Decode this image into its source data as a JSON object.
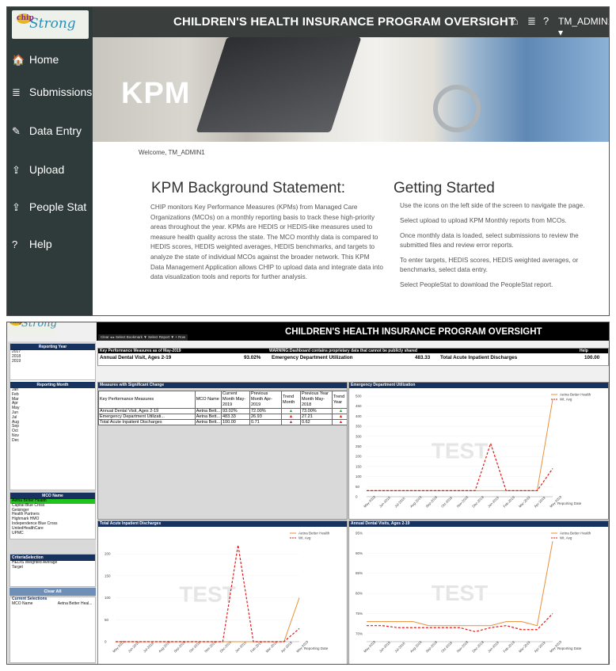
{
  "kpm_page": {
    "logo_text": "Strong",
    "logo_badge": "chip",
    "nav": [
      {
        "label": "Home",
        "icon": "home-icon",
        "glyph": "🏠",
        "active": true
      },
      {
        "label": "Submissions",
        "icon": "server-icon",
        "glyph": "≣"
      },
      {
        "label": "Data Entry",
        "icon": "pencil-icon",
        "glyph": "✎"
      },
      {
        "label": "Upload",
        "icon": "upload-icon",
        "glyph": "⇪"
      },
      {
        "label": "People Stat",
        "icon": "upload-icon",
        "glyph": "⇪"
      },
      {
        "label": "Help",
        "icon": "question-icon",
        "glyph": "?"
      }
    ],
    "header_title": "CHILDREN'S HEALTH INSURANCE PROGRAM OVERSIGHT",
    "user": "TM_ADMIN1 ▾",
    "hero_title": "KPM",
    "welcome": "Welcome, TM_ADMIN1",
    "background_heading": "KPM Background Statement:",
    "background_text": "CHIP monitors Key Performance Measures (KPMs) from Managed Care Organizations (MCOs) on a monthly reporting basis to track these high-priority areas throughout the year. KPMs are HEDIS or HEDIS-like measures used to measure health quality across the state. The MCO monthly data is compared to HEDIS scores, HEDIS weighted averages, HEDIS benchmarks, and targets to analyze the state of individual MCOs against the broader network. This KPM Data Management Application allows CHIP to upload data and integrate data into data visualization tools and reports for further analysis.",
    "getting_started_heading": "Getting Started",
    "getting_started": [
      "Use the icons on the left side of the screen to navigate the page.",
      "Select upload to upload KPM Monthly reports from MCOs.",
      "Once monthly data is loaded, select submissions to review the submitted files and review error reports.",
      "To enter targets, HEDIS scores, HEDIS weighted averages, or benchmarks, select data entry.",
      "Select PeopleStat to download the PeopleStat report."
    ],
    "accent": "#2f3b3a"
  },
  "dashboard": {
    "title": "CHILDREN'S HEALTH INSURANCE PROGRAM OVERSIGHT",
    "toolbar": "Clear  ◂  ▸  Select Bookmark ▼  Select Report ▼  + Row",
    "reporting_year": {
      "label": "Reporting Year",
      "items": [
        "2017",
        "2018",
        "2019"
      ]
    },
    "reporting_month": {
      "label": "Reporting Month",
      "items": [
        "Jan",
        "Feb",
        "Mar",
        "Apr",
        "May",
        "Jun",
        "Jul",
        "Aug",
        "Sep",
        "Oct",
        "Nov",
        "Dec"
      ]
    },
    "mco_name": {
      "label": "MCO Name",
      "items": [
        "Aetna Better Health",
        "Capital Blue Cross",
        "Geisinger",
        "Health Partners",
        "Highmark HMO",
        "Independence Blue Cross",
        "UnitedHealthCare",
        "UPMC"
      ],
      "selected": "Aetna Better Health"
    },
    "criteria": {
      "label": "CriteriaSelection",
      "items": [
        "HEDIS Weighted Average",
        "Target"
      ]
    },
    "clear_all": "Clear All",
    "current_selections": {
      "label": "Current Selections",
      "field": "MCO Name",
      "value": "Aetna Better Heal..."
    },
    "kpm_header": "Key Performance Measures as of May-2019",
    "warning": "WARNING:Dashboard contains proprietary data that cannot be publicly shared",
    "help": "Help",
    "kpis": [
      {
        "label": "Annual Dental Visit, Ages 2-19",
        "value": "93.02%"
      },
      {
        "label": "Emergency Department Utilization",
        "value": "483.33"
      },
      {
        "label": "Total Acute Inpatient Discharges",
        "value": "100.00"
      }
    ],
    "changes_table": {
      "title": "Measures with Significant Change",
      "headers": [
        "Key Performance Measures",
        "MCO Name",
        "Current Month May-2019",
        "Previous Month Apr-2019",
        "Trend Month",
        "Previous Year Month May-2018",
        "Trend Year"
      ],
      "rows": [
        [
          "Annual Dental Visit, Ages 2-19",
          "Aetna Bett...",
          "93.02%",
          "72.00%",
          "up",
          "73.00%",
          "up"
        ],
        [
          "Emergency Department Utilizati...",
          "Aetna Bett...",
          "483.33",
          "26.93",
          "up",
          "27.21",
          "up"
        ],
        [
          "Total Acute Inpatient Discharges",
          "Aetna Bett...",
          "100.00",
          "0.71",
          "up",
          "0.62",
          "up"
        ]
      ]
    },
    "watermark": "TEST",
    "colors": {
      "series1": "#e8903a",
      "series2": "#e21818",
      "header": "#17325e",
      "selected": "#21c21c"
    }
  },
  "chart_data": [
    {
      "type": "line",
      "title": "Emergency Department Utilization",
      "xlabel": "Reporting Date",
      "x": [
        "May-2018",
        "Jun-2018",
        "Jul-2018",
        "Aug-2018",
        "Sep-2018",
        "Oct-2018",
        "Nov-2018",
        "Dec-2018",
        "Jan-2019",
        "Feb-2019",
        "Mar-2019",
        "Apr-2019",
        "May-2019"
      ],
      "series": [
        {
          "name": "Aetna Better Health",
          "values": [
            30,
            30,
            30,
            30,
            30,
            30,
            30,
            30,
            30,
            30,
            30,
            30,
            483.33
          ]
        },
        {
          "name": "Wt. Avg",
          "values": [
            30,
            30,
            30,
            30,
            30,
            30,
            30,
            30,
            265,
            30,
            30,
            30,
            140
          ]
        }
      ],
      "yticks": [
        0,
        50,
        100,
        150,
        200,
        250,
        300,
        350,
        400,
        450,
        500
      ],
      "ylim": [
        0,
        500
      ],
      "legend": "top-right"
    },
    {
      "type": "line",
      "title": "Total Acute Inpatient Discharges",
      "xlabel": "Reporting Date",
      "x": [
        "May-2018",
        "Jun-2018",
        "Jul-2018",
        "Aug-2018",
        "Sep-2018",
        "Oct-2018",
        "Nov-2018",
        "Dec-2018",
        "Jan-2019",
        "Feb-2019",
        "Mar-2019",
        "Apr-2019",
        "May-2019"
      ],
      "series": [
        {
          "name": "Aetna Better Health",
          "values": [
            0,
            0,
            0,
            0,
            0,
            0,
            0,
            0,
            0,
            0,
            0,
            0,
            100
          ]
        },
        {
          "name": "Wt. Avg",
          "values": [
            0,
            0,
            0,
            0,
            0,
            0,
            0,
            0,
            220,
            0,
            0,
            0,
            30
          ]
        }
      ],
      "yticks": [
        0,
        50,
        100,
        150,
        200
      ],
      "ylim": [
        0,
        240
      ],
      "legend": "top-right"
    },
    {
      "type": "line",
      "title": "Annual Dental Visits, Ages 2-19",
      "xlabel": "Reporting Date",
      "x": [
        "May-2018",
        "Jun-2018",
        "Jul-2018",
        "Aug-2018",
        "Sep-2018",
        "Oct-2018",
        "Nov-2018",
        "Dec-2018",
        "Jan-2019",
        "Feb-2019",
        "Mar-2019",
        "Apr-2019",
        "May-2019"
      ],
      "series": [
        {
          "name": "Aetna Better Health",
          "values": [
            73,
            73,
            73,
            73,
            72,
            72,
            72,
            72,
            72,
            73,
            73,
            72,
            93
          ]
        },
        {
          "name": "Wt. Avg",
          "values": [
            72,
            72,
            71.5,
            71.5,
            71.5,
            71.5,
            71.5,
            70.5,
            71.5,
            72,
            71,
            71,
            75
          ]
        }
      ],
      "yticks": [
        "70%",
        "75%",
        "80%",
        "85%",
        "90%",
        "95%"
      ],
      "ylim": [
        68,
        95
      ],
      "legend": "top-right"
    }
  ]
}
